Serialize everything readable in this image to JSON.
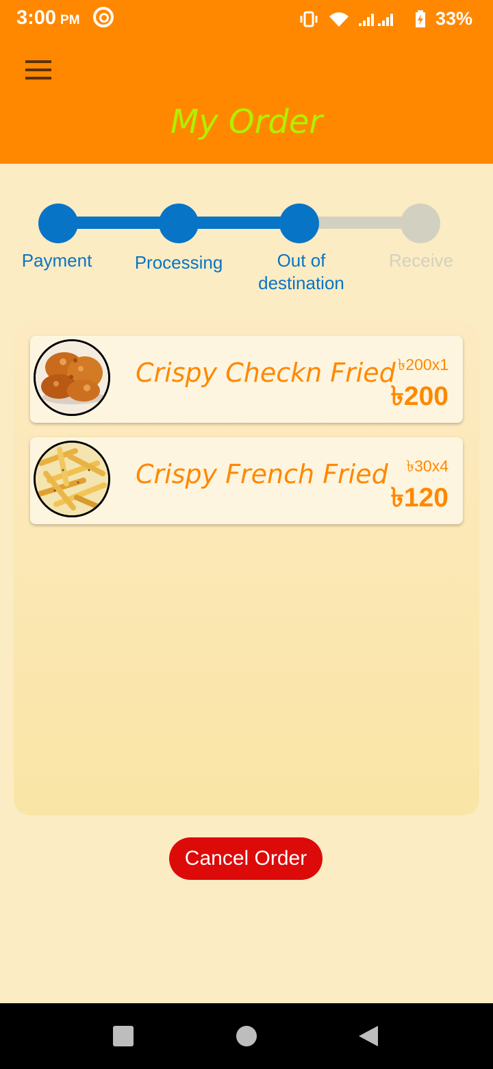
{
  "status_bar": {
    "time": "3:00",
    "ampm": "PM",
    "battery": "33%"
  },
  "header": {
    "title": "My Order"
  },
  "stepper": {
    "steps": [
      {
        "label": "Payment",
        "done": true
      },
      {
        "label": "Processing",
        "done": true
      },
      {
        "label": "Out of destination",
        "done": true
      },
      {
        "label": "Receive",
        "done": false
      }
    ],
    "active_color": "#0874c6",
    "inactive_color": "#d2d1c1"
  },
  "order": {
    "items": [
      {
        "name": "Crispy Checkn Fried",
        "unit_price": "৳200x1",
        "total": "৳200",
        "image": "fried-chicken"
      },
      {
        "name": "Crispy French Fried",
        "unit_price": "৳30x4",
        "total": "৳120",
        "image": "french-fries"
      }
    ]
  },
  "actions": {
    "cancel_label": "Cancel Order"
  },
  "colors": {
    "accent": "#ff8800",
    "title": "#b0f000",
    "cancel": "#dd0a0a",
    "background": "#fcecc3"
  }
}
